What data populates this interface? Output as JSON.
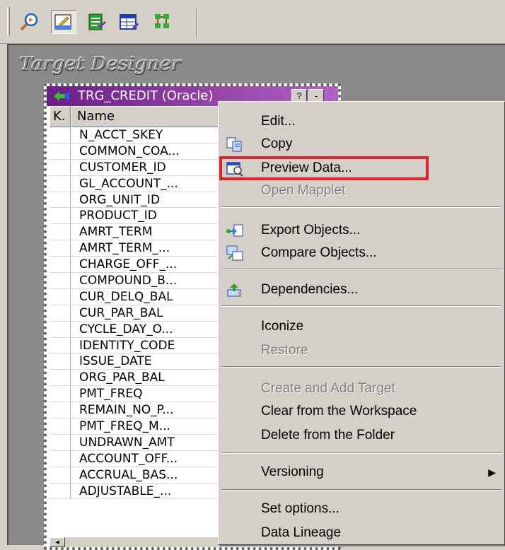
{
  "toolbar": {
    "buttons": [
      {
        "icon": "search-find-icon"
      },
      {
        "icon": "target-designer-icon",
        "active": true
      },
      {
        "icon": "edit-doc-icon"
      },
      {
        "icon": "table-icon"
      },
      {
        "icon": "tree-icon"
      }
    ]
  },
  "workspace": {
    "title": "Target Designer"
  },
  "target": {
    "title": "TRG_CREDIT (Oracle)",
    "help_btn": "?",
    "min_btn": "-",
    "columns": {
      "key": "K.",
      "name": "Name"
    },
    "rows": [
      "N_ACCT_SKEY",
      "COMMON_COA...",
      "CUSTOMER_ID",
      "GL_ACCOUNT_...",
      "ORG_UNIT_ID",
      "PRODUCT_ID",
      "AMRT_TERM",
      "AMRT_TERM_...",
      "CHARGE_OFF_...",
      "COMPOUND_B...",
      "CUR_DELQ_BAL",
      "CUR_PAR_BAL",
      "CYCLE_DAY_O...",
      "IDENTITY_CODE",
      "ISSUE_DATE",
      "ORG_PAR_BAL",
      "PMT_FREQ",
      "REMAIN_NO_P...",
      "PMT_FREQ_M...",
      "UNDRAWN_AMT",
      "ACCOUNT_OFF...",
      "ACCRUAL_BAS...",
      "ADJUSTABLE_..."
    ],
    "scroll_left": "◂"
  },
  "menu": {
    "edit": "Edit...",
    "copy": "Copy",
    "preview": "Preview Data...",
    "open_mapplet": "Open Mapplet",
    "export": "Export Objects...",
    "compare": "Compare Objects...",
    "dependencies": "Dependencies...",
    "iconize": "Iconize",
    "restore": "Restore",
    "create_add": "Create and Add Target",
    "clear": "Clear from the Workspace",
    "delete": "Delete from the Folder",
    "versioning": "Versioning",
    "versioning_arrow": "▶",
    "set_options": "Set options...",
    "lineage": "Data Lineage"
  },
  "colors": {
    "highlight": "#e0202a",
    "title_bar": "#6c1d85"
  }
}
